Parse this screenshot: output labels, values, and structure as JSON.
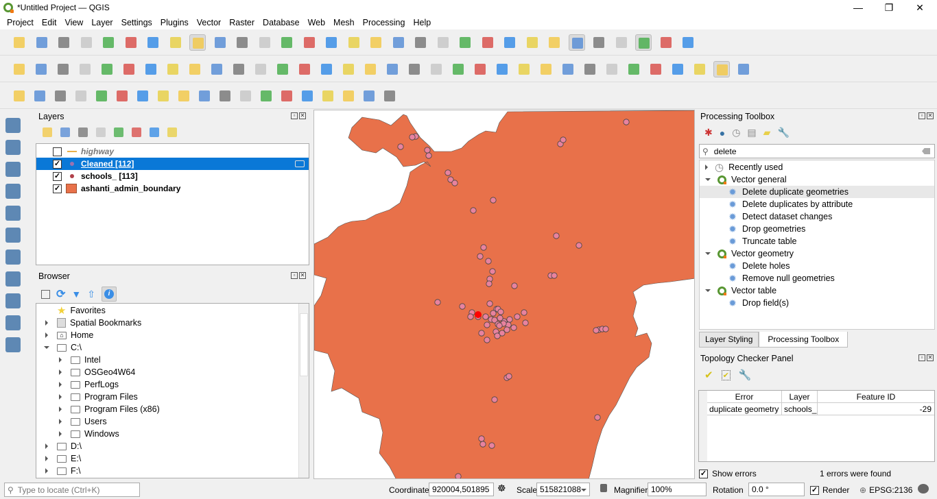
{
  "window": {
    "title": "*Untitled Project — QGIS",
    "minimize": "—",
    "maximize": "❐",
    "close": "✕"
  },
  "menu": [
    "Project",
    "Edit",
    "View",
    "Layer",
    "Settings",
    "Plugins",
    "Vector",
    "Raster",
    "Database",
    "Web",
    "Mesh",
    "Processing",
    "Help"
  ],
  "toolbars": {
    "row1": [
      "new-project",
      "open-project",
      "save-project",
      "new-print-layout",
      "layout-manager",
      "style-manager",
      "pan",
      "pan-to-selection",
      "zoom-in",
      "zoom-out",
      "zoom-full",
      "zoom-to-selection",
      "zoom-to-layer",
      "zoom-native",
      "zoom-last",
      "zoom-next",
      "new-spatial-bookmark",
      "show-bookmarks",
      "new-bookmark",
      "show-spatial-bookmarks",
      "temporal-controller",
      "refresh",
      "identify",
      "attribute-table",
      "field-calculator",
      "processing-toolbox",
      "statistical-summary",
      "measure-line",
      "map-tips",
      "action",
      "text-annotation"
    ],
    "row2": [
      "digitize-layers",
      "add-gpx",
      "new-shapefile",
      "new-temp-scratch",
      "new-virtual",
      "new-spatialite",
      "current-edits",
      "toggle-editing",
      "save-edits",
      "add-point",
      "vertex-tool",
      "modify-attributes",
      "delete-selected",
      "cut",
      "copy",
      "paste",
      "undo",
      "redo",
      "label-toolbar",
      "diagram",
      "pin-labels",
      "highlight-labels",
      "show-hide-labels",
      "move-label",
      "rotate-label",
      "change-label",
      "db-manager",
      "topology",
      "wms-add",
      "wms-search",
      "metasearch",
      "help",
      "topology-checker",
      "table-refresh"
    ],
    "row3": [
      "select-features",
      "select-by-attribute",
      "deselect",
      "select-by-location",
      "locator-search",
      "georeferencer",
      "python-console",
      "heatmap",
      "map-swipe",
      "qgis2web",
      "globe",
      "grass",
      "identify-plus",
      "profile",
      "shape-digitizing",
      "more",
      "locate",
      "more2",
      "road-graph"
    ]
  },
  "layers_panel": {
    "title": "Layers",
    "layers": [
      {
        "name": "highway",
        "checked": false,
        "symbol": "line",
        "color": "#e8b04a",
        "italic": true
      },
      {
        "name": "Cleaned [112]",
        "checked": true,
        "symbol": "point",
        "color": "#9b72b0",
        "selected": true
      },
      {
        "name": "schools_ [113]",
        "checked": true,
        "symbol": "point",
        "color": "#b0414a"
      },
      {
        "name": "ashanti_admin_boundary",
        "checked": true,
        "symbol": "fill",
        "color": "#e8714a"
      }
    ]
  },
  "browser_panel": {
    "title": "Browser",
    "items": [
      {
        "label": "Favorites",
        "icon": "star-icon",
        "level": 0,
        "expand": "none"
      },
      {
        "label": "Spatial Bookmarks",
        "icon": "bookmark-icon",
        "level": 0,
        "expand": "collapsed"
      },
      {
        "label": "Home",
        "icon": "home-icon",
        "level": 0,
        "expand": "collapsed"
      },
      {
        "label": "C:\\",
        "icon": "folder-open-icon",
        "level": 0,
        "expand": "expanded"
      },
      {
        "label": "Intel",
        "icon": "folder-icon",
        "level": 1,
        "expand": "collapsed"
      },
      {
        "label": "OSGeo4W64",
        "icon": "folder-icon",
        "level": 1,
        "expand": "collapsed"
      },
      {
        "label": "PerfLogs",
        "icon": "folder-icon",
        "level": 1,
        "expand": "collapsed"
      },
      {
        "label": "Program Files",
        "icon": "folder-icon",
        "level": 1,
        "expand": "collapsed"
      },
      {
        "label": "Program Files (x86)",
        "icon": "folder-icon",
        "level": 1,
        "expand": "collapsed"
      },
      {
        "label": "Users",
        "icon": "folder-icon",
        "level": 1,
        "expand": "collapsed"
      },
      {
        "label": "Windows",
        "icon": "folder-icon",
        "level": 1,
        "expand": "collapsed"
      },
      {
        "label": "D:\\",
        "icon": "folder-icon",
        "level": 0,
        "expand": "collapsed"
      },
      {
        "label": "E:\\",
        "icon": "folder-icon",
        "level": 0,
        "expand": "collapsed"
      },
      {
        "label": "F:\\",
        "icon": "folder-icon",
        "level": 0,
        "expand": "collapsed"
      }
    ]
  },
  "processing_toolbox": {
    "title": "Processing Toolbox",
    "search_value": "delete",
    "tree": [
      {
        "label": "Recently used",
        "type": "group",
        "icon": "clock-icon",
        "expand": "collapsed"
      },
      {
        "label": "Vector general",
        "type": "group",
        "icon": "qgis-icon",
        "expand": "expanded"
      },
      {
        "label": "Delete duplicate geometries",
        "type": "alg",
        "highlighted": true
      },
      {
        "label": "Delete duplicates by attribute",
        "type": "alg"
      },
      {
        "label": "Detect dataset changes",
        "type": "alg"
      },
      {
        "label": "Drop geometries",
        "type": "alg"
      },
      {
        "label": "Truncate table",
        "type": "alg"
      },
      {
        "label": "Vector geometry",
        "type": "group",
        "icon": "qgis-icon",
        "expand": "expanded"
      },
      {
        "label": "Delete holes",
        "type": "alg"
      },
      {
        "label": "Remove null geometries",
        "type": "alg"
      },
      {
        "label": "Vector table",
        "type": "group",
        "icon": "qgis-icon",
        "expand": "expanded"
      },
      {
        "label": "Drop field(s)",
        "type": "alg"
      }
    ],
    "tabs": [
      {
        "label": "Layer Styling",
        "active": false
      },
      {
        "label": "Processing Toolbox",
        "active": true
      }
    ]
  },
  "topology_checker": {
    "title": "Topology Checker Panel",
    "columns": [
      "Error",
      "Layer",
      "Feature ID"
    ],
    "rows": [
      {
        "index": "0",
        "error": "duplicate geometry",
        "layer": "schools_",
        "feature_id": "-29"
      }
    ],
    "show_errors_label": "Show errors",
    "show_errors_checked": true,
    "status": "1 errors were found"
  },
  "map": {
    "boundary_color": "#e8714a",
    "point_color": "#e8829e",
    "highlight_color": "#ff0000"
  },
  "statusbar": {
    "locator_placeholder": "Type to locate (Ctrl+K)",
    "coordinate_label": "Coordinate",
    "coordinate_value": "920004,501895",
    "scale_label": "Scale",
    "scale_value": "515821088",
    "magnifier_label": "Magnifier",
    "magnifier_value": "100%",
    "rotation_label": "Rotation",
    "rotation_value": "0.0 °",
    "render_label": "Render",
    "render_checked": true,
    "crs": "EPSG:2136"
  }
}
